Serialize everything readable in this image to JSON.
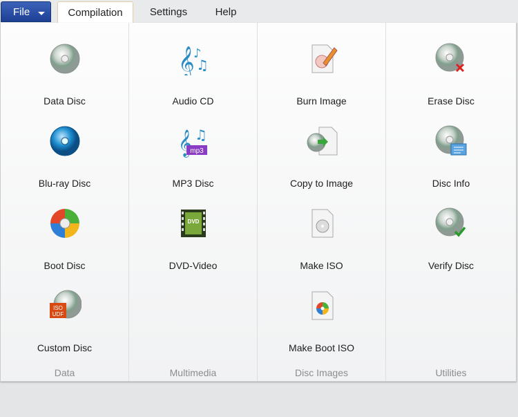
{
  "tabs": {
    "file": "File",
    "items": [
      "Compilation",
      "Settings",
      "Help"
    ],
    "active": "Compilation"
  },
  "groups": [
    {
      "label": "Data",
      "items": [
        {
          "label": "Data Disc",
          "icon": "data-disc-icon"
        },
        {
          "label": "Blu-ray Disc",
          "icon": "bluray-disc-icon"
        },
        {
          "label": "Boot Disc",
          "icon": "boot-disc-icon"
        },
        {
          "label": "Custom Disc",
          "icon": "custom-disc-icon",
          "badge": [
            "ISO",
            "UDF"
          ]
        }
      ]
    },
    {
      "label": "Multimedia",
      "items": [
        {
          "label": "Audio CD",
          "icon": "music-notes-icon"
        },
        {
          "label": "MP3 Disc",
          "icon": "mp3-icon",
          "badge": "mp3"
        },
        {
          "label": "DVD-Video",
          "icon": "film-dvd-icon",
          "badge": "DVD"
        }
      ]
    },
    {
      "label": "Disc Images",
      "items": [
        {
          "label": "Burn Image",
          "icon": "burn-image-icon"
        },
        {
          "label": "Copy to Image",
          "icon": "copy-to-image-icon"
        },
        {
          "label": "Make ISO",
          "icon": "make-iso-icon"
        },
        {
          "label": "Make Boot ISO",
          "icon": "make-boot-iso-icon"
        }
      ]
    },
    {
      "label": "Utilities",
      "items": [
        {
          "label": "Erase Disc",
          "icon": "erase-disc-icon"
        },
        {
          "label": "Disc Info",
          "icon": "disc-info-icon"
        },
        {
          "label": "Verify Disc",
          "icon": "verify-disc-icon"
        }
      ]
    }
  ]
}
